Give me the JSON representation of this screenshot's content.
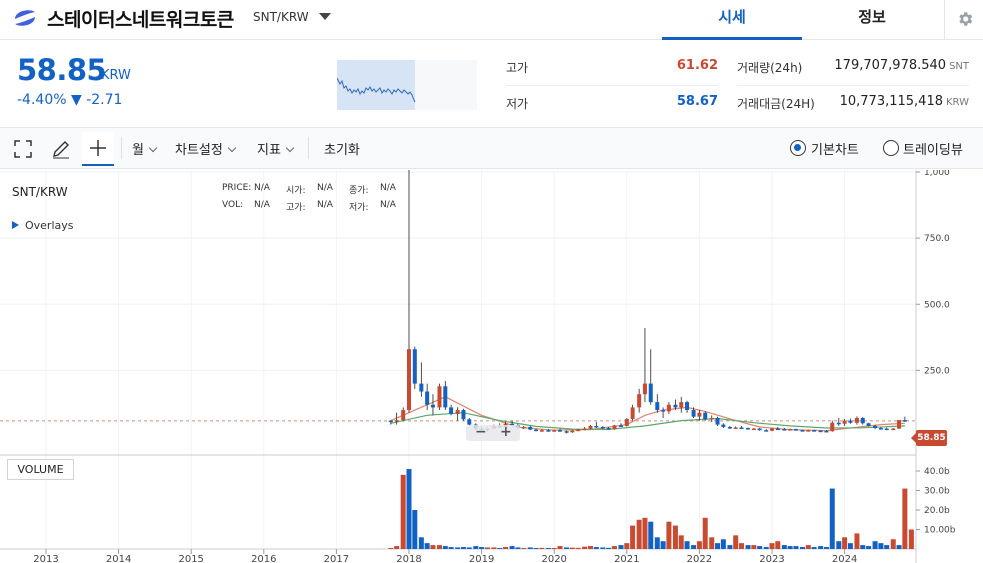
{
  "header": {
    "coin_name": "스테이터스네트워크토큰",
    "pair": "SNT/KRW",
    "tabs": [
      {
        "label": "시세",
        "active": true
      },
      {
        "label": "정보",
        "active": false
      }
    ]
  },
  "quote": {
    "price": "58.85",
    "unit": "KRW",
    "change": "-4.40% ▼ -2.71",
    "stats_left": [
      {
        "label": "고가",
        "value": "61.62",
        "color": "#c84a31"
      },
      {
        "label": "저가",
        "value": "58.67",
        "color": "#1261c4"
      }
    ],
    "stats_right": [
      {
        "label": "거래량(24h)",
        "value": "179,707,978.540",
        "unit": "SNT"
      },
      {
        "label": "거래대금(24H)",
        "value": "10,773,115,418",
        "unit": "KRW"
      }
    ]
  },
  "toolbar": {
    "period_label": "월",
    "settings_label": "차트설정",
    "indicator_label": "지표",
    "reset_label": "초기화",
    "view_basic_label": "기본차트",
    "view_trading_label": "트레이딩뷰",
    "selected_view": "기본차트"
  },
  "chart": {
    "symbol": "SNT/KRW",
    "overlays_label": "Overlays",
    "ohlc_legend": [
      {
        "key": "PRICE:",
        "val": "N/A"
      },
      {
        "key": "시가:",
        "val": "N/A"
      },
      {
        "key": "종가:",
        "val": "N/A"
      },
      {
        "key": "VOL:",
        "val": "N/A"
      },
      {
        "key": "고가:",
        "val": "N/A"
      },
      {
        "key": "저가:",
        "val": "N/A"
      }
    ],
    "volume_label": "VOLUME",
    "last_price_tag": "58.85",
    "zoom_out": "−",
    "zoom_in": "+"
  },
  "chart_data": {
    "type": "candlestick",
    "y_ticks": [
      "1,000",
      "750.0",
      "500.0",
      "250.0"
    ],
    "y_tick_values": [
      1000,
      750,
      500,
      250
    ],
    "volume_ticks": [
      "40.0b",
      "30.0b",
      "20.0b",
      "10.00b"
    ],
    "volume_tick_values": [
      40,
      30,
      20,
      10
    ],
    "x_ticks": [
      "2013",
      "2014",
      "2015",
      "2016",
      "2017",
      "2018",
      "2019",
      "2020",
      "2021",
      "2022",
      "2023",
      "2024"
    ],
    "ylim": [
      0,
      1000
    ],
    "volume_ylim": [
      0,
      40
    ],
    "up_color": "#c84a31",
    "down_color": "#1261c4",
    "candles": [
      [
        2017.75,
        60,
        62,
        45,
        58
      ],
      [
        2017.83,
        58,
        90,
        45,
        62
      ],
      [
        2017.92,
        62,
        110,
        58,
        100
      ],
      [
        2018.0,
        100,
        1045,
        90,
        330
      ],
      [
        2018.08,
        330,
        340,
        180,
        200
      ],
      [
        2018.17,
        200,
        280,
        150,
        170
      ],
      [
        2018.25,
        170,
        200,
        100,
        120
      ],
      [
        2018.33,
        120,
        160,
        80,
        110
      ],
      [
        2018.42,
        110,
        200,
        100,
        190
      ],
      [
        2018.5,
        190,
        210,
        100,
        110
      ],
      [
        2018.58,
        110,
        120,
        80,
        85
      ],
      [
        2018.67,
        85,
        110,
        60,
        100
      ],
      [
        2018.75,
        100,
        105,
        60,
        65
      ],
      [
        2018.83,
        65,
        70,
        40,
        45
      ],
      [
        2018.92,
        45,
        50,
        25,
        30
      ],
      [
        2019.0,
        30,
        38,
        22,
        25
      ],
      [
        2019.08,
        25,
        35,
        20,
        30
      ],
      [
        2019.17,
        30,
        45,
        28,
        40
      ],
      [
        2019.25,
        40,
        50,
        32,
        35
      ],
      [
        2019.33,
        35,
        55,
        30,
        48
      ],
      [
        2019.42,
        48,
        60,
        38,
        42
      ],
      [
        2019.5,
        42,
        48,
        30,
        32
      ],
      [
        2019.58,
        32,
        40,
        28,
        36
      ],
      [
        2019.67,
        36,
        40,
        24,
        26
      ],
      [
        2019.75,
        26,
        30,
        20,
        22
      ],
      [
        2019.83,
        22,
        28,
        18,
        24
      ],
      [
        2019.92,
        24,
        28,
        18,
        20
      ],
      [
        2020.0,
        20,
        26,
        18,
        24
      ],
      [
        2020.08,
        24,
        30,
        18,
        20
      ],
      [
        2020.17,
        20,
        22,
        12,
        16
      ],
      [
        2020.25,
        16,
        24,
        14,
        22
      ],
      [
        2020.33,
        22,
        28,
        20,
        26
      ],
      [
        2020.42,
        26,
        36,
        24,
        30
      ],
      [
        2020.5,
        30,
        44,
        28,
        40
      ],
      [
        2020.58,
        40,
        55,
        32,
        36
      ],
      [
        2020.67,
        36,
        40,
        28,
        32
      ],
      [
        2020.75,
        32,
        36,
        26,
        28
      ],
      [
        2020.83,
        28,
        44,
        26,
        42
      ],
      [
        2020.92,
        42,
        50,
        36,
        40
      ],
      [
        2021.0,
        40,
        70,
        38,
        66
      ],
      [
        2021.08,
        66,
        120,
        60,
        110
      ],
      [
        2021.17,
        110,
        180,
        90,
        160
      ],
      [
        2021.25,
        160,
        410,
        130,
        200
      ],
      [
        2021.33,
        200,
        330,
        120,
        130
      ],
      [
        2021.42,
        130,
        160,
        90,
        100
      ],
      [
        2021.5,
        100,
        110,
        70,
        95
      ],
      [
        2021.58,
        95,
        130,
        85,
        120
      ],
      [
        2021.67,
        120,
        140,
        100,
        110
      ],
      [
        2021.75,
        110,
        150,
        90,
        130
      ],
      [
        2021.83,
        130,
        135,
        90,
        100
      ],
      [
        2021.92,
        100,
        110,
        70,
        75
      ],
      [
        2022.0,
        75,
        100,
        60,
        90
      ],
      [
        2022.08,
        90,
        95,
        60,
        65
      ],
      [
        2022.17,
        65,
        80,
        55,
        70
      ],
      [
        2022.25,
        70,
        75,
        40,
        45
      ],
      [
        2022.33,
        45,
        50,
        32,
        36
      ],
      [
        2022.42,
        36,
        40,
        28,
        32
      ],
      [
        2022.5,
        32,
        38,
        28,
        34
      ],
      [
        2022.58,
        34,
        40,
        30,
        32
      ],
      [
        2022.67,
        32,
        34,
        26,
        28
      ],
      [
        2022.75,
        28,
        32,
        26,
        30
      ],
      [
        2022.83,
        30,
        32,
        22,
        24
      ],
      [
        2022.92,
        24,
        28,
        20,
        22
      ],
      [
        2023.0,
        22,
        32,
        20,
        30
      ],
      [
        2023.08,
        30,
        36,
        26,
        28
      ],
      [
        2023.17,
        28,
        32,
        24,
        26
      ],
      [
        2023.25,
        26,
        30,
        24,
        28
      ],
      [
        2023.33,
        28,
        30,
        22,
        24
      ],
      [
        2023.42,
        24,
        26,
        20,
        22
      ],
      [
        2023.5,
        22,
        26,
        20,
        24
      ],
      [
        2023.58,
        24,
        26,
        20,
        22
      ],
      [
        2023.67,
        22,
        24,
        20,
        21
      ],
      [
        2023.75,
        21,
        24,
        18,
        20
      ],
      [
        2023.83,
        20,
        60,
        18,
        52
      ],
      [
        2023.92,
        52,
        70,
        40,
        48
      ],
      [
        2024.0,
        48,
        66,
        40,
        60
      ],
      [
        2024.08,
        60,
        68,
        48,
        52
      ],
      [
        2024.17,
        52,
        76,
        45,
        70
      ],
      [
        2024.25,
        70,
        74,
        45,
        50
      ],
      [
        2024.33,
        50,
        52,
        38,
        40
      ],
      [
        2024.42,
        40,
        44,
        28,
        32
      ],
      [
        2024.5,
        32,
        36,
        26,
        30
      ],
      [
        2024.58,
        30,
        34,
        24,
        28
      ],
      [
        2024.67,
        28,
        32,
        24,
        30
      ],
      [
        2024.75,
        30,
        60,
        28,
        62
      ],
      [
        2024.83,
        62,
        75,
        55,
        58.85
      ]
    ],
    "volume": [
      [
        2017.75,
        0.5,
        "u"
      ],
      [
        2017.83,
        1.5,
        "u"
      ],
      [
        2017.92,
        38,
        "u"
      ],
      [
        2018.0,
        41,
        "d"
      ],
      [
        2018.08,
        20,
        "d"
      ],
      [
        2018.17,
        6,
        "d"
      ],
      [
        2018.25,
        3,
        "d"
      ],
      [
        2018.33,
        2,
        "u"
      ],
      [
        2018.42,
        2,
        "u"
      ],
      [
        2018.5,
        1.5,
        "d"
      ],
      [
        2018.58,
        1,
        "d"
      ],
      [
        2018.67,
        0.8,
        "d"
      ],
      [
        2018.75,
        1,
        "d"
      ],
      [
        2018.83,
        0.8,
        "d"
      ],
      [
        2018.92,
        1.5,
        "d"
      ],
      [
        2019.0,
        1,
        "d"
      ],
      [
        2019.08,
        0.8,
        "u"
      ],
      [
        2019.17,
        0.8,
        "u"
      ],
      [
        2019.25,
        0.5,
        "d"
      ],
      [
        2019.33,
        1,
        "u"
      ],
      [
        2019.42,
        1.5,
        "d"
      ],
      [
        2019.5,
        0.8,
        "d"
      ],
      [
        2019.58,
        0.5,
        "u"
      ],
      [
        2019.67,
        0.8,
        "d"
      ],
      [
        2019.75,
        0.5,
        "d"
      ],
      [
        2019.83,
        0.6,
        "u"
      ],
      [
        2019.92,
        0.5,
        "d"
      ],
      [
        2020.0,
        0.5,
        "u"
      ],
      [
        2020.08,
        1.5,
        "u"
      ],
      [
        2020.17,
        0.8,
        "d"
      ],
      [
        2020.25,
        0.7,
        "u"
      ],
      [
        2020.33,
        0.6,
        "u"
      ],
      [
        2020.42,
        1.2,
        "u"
      ],
      [
        2020.5,
        1.5,
        "u"
      ],
      [
        2020.58,
        1,
        "d"
      ],
      [
        2020.67,
        0.8,
        "d"
      ],
      [
        2020.75,
        0.6,
        "d"
      ],
      [
        2020.83,
        1.5,
        "u"
      ],
      [
        2020.92,
        2,
        "d"
      ],
      [
        2021.0,
        3,
        "u"
      ],
      [
        2021.08,
        12,
        "u"
      ],
      [
        2021.17,
        15,
        "u"
      ],
      [
        2021.25,
        16,
        "u"
      ],
      [
        2021.33,
        14,
        "d"
      ],
      [
        2021.42,
        6,
        "d"
      ],
      [
        2021.5,
        4,
        "d"
      ],
      [
        2021.58,
        14,
        "u"
      ],
      [
        2021.67,
        12,
        "u"
      ],
      [
        2021.75,
        7,
        "u"
      ],
      [
        2021.83,
        4,
        "d"
      ],
      [
        2021.92,
        2,
        "d"
      ],
      [
        2022.0,
        4,
        "u"
      ],
      [
        2022.08,
        16,
        "u"
      ],
      [
        2022.17,
        6,
        "u"
      ],
      [
        2022.25,
        3,
        "d"
      ],
      [
        2022.33,
        5,
        "d"
      ],
      [
        2022.42,
        2,
        "d"
      ],
      [
        2022.5,
        7,
        "u"
      ],
      [
        2022.58,
        3,
        "u"
      ],
      [
        2022.67,
        2,
        "d"
      ],
      [
        2022.75,
        2,
        "u"
      ],
      [
        2022.83,
        1.5,
        "d"
      ],
      [
        2022.92,
        1,
        "d"
      ],
      [
        2023.0,
        3,
        "u"
      ],
      [
        2023.08,
        4,
        "u"
      ],
      [
        2023.17,
        2,
        "d"
      ],
      [
        2023.25,
        1.5,
        "d"
      ],
      [
        2023.33,
        1.5,
        "d"
      ],
      [
        2023.42,
        1,
        "d"
      ],
      [
        2023.5,
        2,
        "u"
      ],
      [
        2023.58,
        1,
        "d"
      ],
      [
        2023.67,
        1.5,
        "d"
      ],
      [
        2023.75,
        1,
        "d"
      ],
      [
        2023.83,
        31,
        "d"
      ],
      [
        2023.92,
        4,
        "d"
      ],
      [
        2024.0,
        6,
        "u"
      ],
      [
        2024.08,
        3,
        "d"
      ],
      [
        2024.17,
        8,
        "u"
      ],
      [
        2024.25,
        2,
        "d"
      ],
      [
        2024.33,
        1.5,
        "d"
      ],
      [
        2024.42,
        4,
        "d"
      ],
      [
        2024.5,
        3,
        "d"
      ],
      [
        2024.58,
        2,
        "d"
      ],
      [
        2024.67,
        5,
        "u"
      ],
      [
        2024.75,
        2,
        "d"
      ],
      [
        2024.83,
        31,
        "u"
      ],
      [
        2024.92,
        10,
        "u"
      ]
    ],
    "ma_series": [
      {
        "color": "#e0836b",
        "points": [
          [
            2017.75,
            60
          ],
          [
            2018.0,
            90
          ],
          [
            2018.5,
            150
          ],
          [
            2019.0,
            80
          ],
          [
            2019.5,
            35
          ],
          [
            2020.0,
            24
          ],
          [
            2020.5,
            26
          ],
          [
            2021.0,
            45
          ],
          [
            2021.25,
            80
          ],
          [
            2021.5,
            100
          ],
          [
            2021.83,
            110
          ],
          [
            2022.08,
            95
          ],
          [
            2022.5,
            60
          ],
          [
            2022.83,
            36
          ],
          [
            2023.25,
            26
          ],
          [
            2023.75,
            22
          ],
          [
            2024.0,
            30
          ],
          [
            2024.5,
            45
          ],
          [
            2024.83,
            50
          ]
        ]
      },
      {
        "color": "#5aa86b",
        "points": [
          [
            2017.75,
            50
          ],
          [
            2018.25,
            80
          ],
          [
            2018.75,
            90
          ],
          [
            2019.25,
            60
          ],
          [
            2019.75,
            38
          ],
          [
            2020.25,
            28
          ],
          [
            2020.75,
            27
          ],
          [
            2021.25,
            40
          ],
          [
            2021.75,
            60
          ],
          [
            2022.25,
            68
          ],
          [
            2022.75,
            52
          ],
          [
            2023.25,
            40
          ],
          [
            2023.75,
            32
          ],
          [
            2024.25,
            33
          ],
          [
            2024.83,
            40
          ]
        ]
      }
    ]
  }
}
